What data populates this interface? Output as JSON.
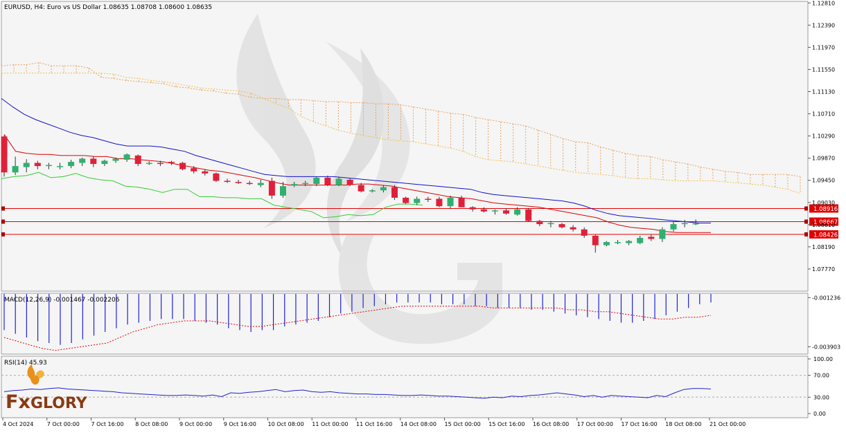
{
  "header": {
    "symbol_line": "EURUSD, H4:  Euro vs US Dollar  1.08635 1.08708 1.08600 1.08635"
  },
  "chart_data": {
    "type": "candlestick",
    "symbol": "EURUSD",
    "timeframe": "H4",
    "description": "Euro vs US Dollar",
    "ohlc_header": {
      "open": 1.08635,
      "high": 1.08708,
      "low": 1.086,
      "close": 1.08635
    },
    "price_axis": {
      "ylim": [
        1.0735,
        1.1284
      ],
      "ticks": [
        "1.12810",
        "1.12390",
        "1.11970",
        "1.11550",
        "1.11130",
        "1.10710",
        "1.10290",
        "1.09870",
        "1.09450",
        "1.09030",
        "1.08610",
        "1.08190",
        "1.07770"
      ]
    },
    "time_axis_labels": [
      "4 Oct 2024",
      "7 Oct 00:00",
      "7 Oct 16:00",
      "8 Oct 08:00",
      "9 Oct 00:00",
      "9 Oct 16:00",
      "10 Oct 08:00",
      "11 Oct 00:00",
      "11 Oct 16:00",
      "14 Oct 08:00",
      "15 Oct 00:00",
      "15 Oct 16:00",
      "16 Oct 08:00",
      "17 Oct 00:00",
      "17 Oct 16:00",
      "18 Oct 08:00",
      "21 Oct 00:00"
    ],
    "candles": [
      {
        "o": 1.1028,
        "h": 1.103,
        "l": 1.0952,
        "c": 1.096
      },
      {
        "o": 1.096,
        "h": 1.099,
        "l": 1.0955,
        "c": 1.0972
      },
      {
        "o": 1.097,
        "h": 1.0985,
        "l": 1.096,
        "c": 1.0978
      },
      {
        "o": 1.0978,
        "h": 1.0982,
        "l": 1.0966,
        "c": 1.0972
      },
      {
        "o": 1.0972,
        "h": 1.0978,
        "l": 1.0966,
        "c": 1.0974
      },
      {
        "o": 1.097,
        "h": 1.0978,
        "l": 1.0966,
        "c": 1.0972
      },
      {
        "o": 1.0972,
        "h": 1.0984,
        "l": 1.0968,
        "c": 1.098
      },
      {
        "o": 1.0978,
        "h": 1.0988,
        "l": 1.0972,
        "c": 1.0986
      },
      {
        "o": 1.0986,
        "h": 1.099,
        "l": 1.097,
        "c": 1.0976
      },
      {
        "o": 1.0976,
        "h": 1.0984,
        "l": 1.0972,
        "c": 1.0982
      },
      {
        "o": 1.0982,
        "h": 1.0988,
        "l": 1.0978,
        "c": 1.0986
      },
      {
        "o": 1.0984,
        "h": 1.0996,
        "l": 1.098,
        "c": 1.0994
      },
      {
        "o": 1.0992,
        "h": 1.0994,
        "l": 1.0972,
        "c": 1.0976
      },
      {
        "o": 1.0978,
        "h": 1.0981,
        "l": 1.0974,
        "c": 1.0978
      },
      {
        "o": 1.0978,
        "h": 1.0982,
        "l": 1.0972,
        "c": 1.0976
      },
      {
        "o": 1.098,
        "h": 1.0982,
        "l": 1.0974,
        "c": 1.0978
      },
      {
        "o": 1.0978,
        "h": 1.098,
        "l": 1.0964,
        "c": 1.0966
      },
      {
        "o": 1.0968,
        "h": 1.0972,
        "l": 1.0958,
        "c": 1.0962
      },
      {
        "o": 1.0962,
        "h": 1.0966,
        "l": 1.0954,
        "c": 1.0958
      },
      {
        "o": 1.0958,
        "h": 1.096,
        "l": 1.0942,
        "c": 1.0944
      },
      {
        "o": 1.0944,
        "h": 1.0948,
        "l": 1.094,
        "c": 1.0942
      },
      {
        "o": 1.0942,
        "h": 1.0946,
        "l": 1.0938,
        "c": 1.094
      },
      {
        "o": 1.094,
        "h": 1.0944,
        "l": 1.0936,
        "c": 1.0938
      },
      {
        "o": 1.0936,
        "h": 1.0946,
        "l": 1.0932,
        "c": 1.094
      },
      {
        "o": 1.0944,
        "h": 1.095,
        "l": 1.091,
        "c": 1.0916
      },
      {
        "o": 1.0916,
        "h": 1.0942,
        "l": 1.0912,
        "c": 1.0934
      },
      {
        "o": 1.0935,
        "h": 1.0942,
        "l": 1.0932,
        "c": 1.0938
      },
      {
        "o": 1.0938,
        "h": 1.0944,
        "l": 1.0934,
        "c": 1.094
      },
      {
        "o": 1.0938,
        "h": 1.0952,
        "l": 1.0934,
        "c": 1.095
      },
      {
        "o": 1.095,
        "h": 1.0954,
        "l": 1.0934,
        "c": 1.0936
      },
      {
        "o": 1.0936,
        "h": 1.0952,
        "l": 1.0934,
        "c": 1.0948
      },
      {
        "o": 1.0946,
        "h": 1.0949,
        "l": 1.0934,
        "c": 1.0936
      },
      {
        "o": 1.0936,
        "h": 1.094,
        "l": 1.0922,
        "c": 1.0924
      },
      {
        "o": 1.0924,
        "h": 1.0928,
        "l": 1.0922,
        "c": 1.0926
      },
      {
        "o": 1.0926,
        "h": 1.0936,
        "l": 1.0922,
        "c": 1.0932
      },
      {
        "o": 1.0932,
        "h": 1.0936,
        "l": 1.0908,
        "c": 1.0912
      },
      {
        "o": 1.0912,
        "h": 1.0914,
        "l": 1.09,
        "c": 1.0902
      },
      {
        "o": 1.0902,
        "h": 1.0914,
        "l": 1.0898,
        "c": 1.091
      },
      {
        "o": 1.091,
        "h": 1.0914,
        "l": 1.0904,
        "c": 1.0908
      },
      {
        "o": 1.091,
        "h": 1.0914,
        "l": 1.0894,
        "c": 1.0896
      },
      {
        "o": 1.0896,
        "h": 1.0916,
        "l": 1.0892,
        "c": 1.0912
      },
      {
        "o": 1.0912,
        "h": 1.0916,
        "l": 1.0894,
        "c": 1.0894
      },
      {
        "o": 1.0894,
        "h": 1.0896,
        "l": 1.0886,
        "c": 1.089
      },
      {
        "o": 1.089,
        "h": 1.0894,
        "l": 1.0884,
        "c": 1.0886
      },
      {
        "o": 1.0886,
        "h": 1.089,
        "l": 1.088,
        "c": 1.0888
      },
      {
        "o": 1.0888,
        "h": 1.0892,
        "l": 1.088,
        "c": 1.0882
      },
      {
        "o": 1.088,
        "h": 1.0894,
        "l": 1.0878,
        "c": 1.089
      },
      {
        "o": 1.089,
        "h": 1.0892,
        "l": 1.0866,
        "c": 1.0868
      },
      {
        "o": 1.0868,
        "h": 1.087,
        "l": 1.0858,
        "c": 1.0862
      },
      {
        "o": 1.0862,
        "h": 1.0868,
        "l": 1.0856,
        "c": 1.0864
      },
      {
        "o": 1.0862,
        "h": 1.0864,
        "l": 1.0854,
        "c": 1.0856
      },
      {
        "o": 1.0856,
        "h": 1.086,
        "l": 1.0848,
        "c": 1.0852
      },
      {
        "o": 1.0852,
        "h": 1.0856,
        "l": 1.0836,
        "c": 1.084
      },
      {
        "o": 1.084,
        "h": 1.0842,
        "l": 1.0808,
        "c": 1.0822
      },
      {
        "o": 1.0822,
        "h": 1.083,
        "l": 1.082,
        "c": 1.0828
      },
      {
        "o": 1.0826,
        "h": 1.0832,
        "l": 1.0824,
        "c": 1.0828
      },
      {
        "o": 1.0826,
        "h": 1.0832,
        "l": 1.0822,
        "c": 1.083
      },
      {
        "o": 1.0826,
        "h": 1.084,
        "l": 1.0824,
        "c": 1.0836
      },
      {
        "o": 1.0838,
        "h": 1.0842,
        "l": 1.083,
        "c": 1.0834
      },
      {
        "o": 1.0834,
        "h": 1.0856,
        "l": 1.0828,
        "c": 1.0852
      },
      {
        "o": 1.0852,
        "h": 1.0866,
        "l": 1.0848,
        "c": 1.0862
      },
      {
        "o": 1.0862,
        "h": 1.087,
        "l": 1.0856,
        "c": 1.0864
      },
      {
        "o": 1.08635,
        "h": 1.08708,
        "l": 1.086,
        "c": 1.08635
      }
    ],
    "ichimoku": {
      "kijun_blue": [
        1.11,
        1.1084,
        1.107,
        1.106,
        1.1052,
        1.1044,
        1.1036,
        1.103,
        1.1026,
        1.102,
        1.1014,
        1.101,
        1.101,
        1.101,
        1.1008,
        1.1004,
        1.1,
        1.0992,
        1.0986,
        1.098,
        1.0974,
        1.0968,
        1.0962,
        1.0956,
        1.0954,
        1.0952,
        1.0952,
        1.0952,
        1.0952,
        1.0952,
        1.095,
        1.0948,
        1.0946,
        1.0944,
        1.0942,
        1.094,
        1.0938,
        1.0936,
        1.0934,
        1.0932,
        1.093,
        1.0928,
        1.0922,
        1.0918,
        1.0916,
        1.0914,
        1.0912,
        1.091,
        1.0908,
        1.0906,
        1.0902,
        1.0896,
        1.0888,
        1.0882,
        1.0878,
        1.0876,
        1.0874,
        1.0872,
        1.087,
        1.0868,
        1.0866,
        1.0864,
        1.0864
      ],
      "tenkan_red": [
        1.1032,
        1.1,
        1.0996,
        1.0994,
        1.0994,
        1.0992,
        1.0992,
        1.0992,
        1.099,
        1.099,
        1.0986,
        1.0986,
        1.0984,
        1.0982,
        1.098,
        1.0976,
        1.0972,
        1.0968,
        1.0964,
        1.0962,
        1.0958,
        1.0954,
        1.095,
        1.0945,
        1.094,
        1.0936,
        1.0936,
        1.0936,
        1.0936,
        1.0936,
        1.0936,
        1.0938,
        1.0938,
        1.0936,
        1.0934,
        1.093,
        1.0926,
        1.0922,
        1.0918,
        1.0914,
        1.0912,
        1.091,
        1.0906,
        1.0902,
        1.09,
        1.0898,
        1.0896,
        1.0894,
        1.089,
        1.0886,
        1.0882,
        1.0878,
        1.0874,
        1.0866,
        1.086,
        1.0856,
        1.0854,
        1.0852,
        1.0848,
        1.0846,
        1.0846,
        1.0846,
        1.0846
      ],
      "chikou_green": [
        1.0948,
        1.0952,
        1.0954,
        1.096,
        1.095,
        1.0952,
        1.0958,
        1.095,
        1.0946,
        1.0944,
        1.0934,
        1.0932,
        1.0928,
        1.0922,
        1.0928,
        1.0928,
        1.0914,
        1.0914,
        1.0912,
        1.0912,
        1.091,
        1.091,
        1.0898,
        1.0894,
        1.089,
        1.0886,
        1.0874,
        1.0876,
        1.088,
        1.0878,
        1.088,
        1.0894,
        1.09,
        1.09,
        1.0898
      ],
      "cloud_upper": [
        1.1162,
        1.1164,
        1.1164,
        1.1168,
        1.1162,
        1.1162,
        1.1162,
        1.1158,
        1.114,
        1.1138,
        1.1134,
        1.1132,
        1.113,
        1.1128,
        1.1122,
        1.112,
        1.1116,
        1.1114,
        1.111,
        1.1108,
        1.1102,
        1.11,
        1.11,
        1.1098,
        1.1098,
        1.1096,
        1.1094,
        1.1094,
        1.1092,
        1.1092,
        1.109,
        1.109,
        1.1088,
        1.1084,
        1.108,
        1.1076,
        1.1072,
        1.107,
        1.1064,
        1.106,
        1.1056,
        1.1052,
        1.1048,
        1.104,
        1.1032,
        1.1024,
        1.1018,
        1.1016,
        1.1008,
        1.1002,
        1.0996,
        1.0992,
        1.099,
        1.0984,
        1.098,
        1.0976,
        1.097,
        1.0966,
        1.0962,
        1.096,
        1.0956,
        1.0956,
        1.0956,
        1.0956,
        1.0952
      ],
      "cloud_lower": [
        1.1148,
        1.1148,
        1.1148,
        1.1148,
        1.1148,
        1.1148,
        1.1148,
        1.1148,
        1.1148,
        1.1146,
        1.114,
        1.1138,
        1.1134,
        1.1132,
        1.1128,
        1.1124,
        1.112,
        1.1118,
        1.1116,
        1.1114,
        1.111,
        1.11,
        1.109,
        1.1082,
        1.1066,
        1.1056,
        1.1048,
        1.104,
        1.1034,
        1.103,
        1.1026,
        1.1022,
        1.102,
        1.1018,
        1.1014,
        1.101,
        1.1006,
        1.1,
        1.099,
        1.0984,
        1.0982,
        1.098,
        1.0976,
        1.0972,
        1.0968,
        1.0964,
        1.096,
        1.0958,
        1.0956,
        1.0954,
        1.095,
        1.0948,
        1.0948,
        1.0946,
        1.0944,
        1.0944,
        1.0944,
        1.0944,
        1.0942,
        1.094,
        1.0938,
        1.0936,
        1.0932,
        1.0928,
        1.092
      ]
    },
    "horizontal_levels": [
      {
        "price": 1.08916,
        "label": "1.08916"
      },
      {
        "price": 1.08667,
        "label": "1.08667"
      },
      {
        "price": 1.08426,
        "label": "1.08426"
      }
    ],
    "macd": {
      "label": "MACD(12,26,9) -0.001467 -0.002206",
      "ticks": [
        "-0.001236",
        "-0.003903"
      ],
      "ylim": [
        -0.0043,
        -0.001
      ],
      "histogram": [
        -0.003,
        -0.0032,
        -0.0034,
        -0.0036,
        -0.0037,
        -0.0038,
        -0.0037,
        -0.0035,
        -0.0033,
        -0.0031,
        -0.0029,
        -0.0027,
        -0.0026,
        -0.0025,
        -0.0024,
        -0.0024,
        -0.0024,
        -0.0025,
        -0.0026,
        -0.0027,
        -0.0029,
        -0.003,
        -0.0031,
        -0.003,
        -0.003,
        -0.0028,
        -0.0027,
        -0.0026,
        -0.0025,
        -0.0023,
        -0.0021,
        -0.002,
        -0.0018,
        -0.0017,
        -0.0016,
        -0.0015,
        -0.0015,
        -0.0015,
        -0.0015,
        -0.0016,
        -0.0016,
        -0.0016,
        -0.0017,
        -0.0017,
        -0.0018,
        -0.0018,
        -0.0018,
        -0.0019,
        -0.0019,
        -0.002,
        -0.0021,
        -0.0022,
        -0.0023,
        -0.0024,
        -0.0025,
        -0.0026,
        -0.0026,
        -0.0025,
        -0.0024,
        -0.0022,
        -0.002,
        -0.0018,
        -0.0016,
        -0.0015
      ],
      "signal": [
        -0.0034,
        -0.0036,
        -0.0038,
        -0.004,
        -0.0041,
        -0.004,
        -0.0039,
        -0.0038,
        -0.0037,
        -0.0034,
        -0.0031,
        -0.0029,
        -0.0027,
        -0.0026,
        -0.0025,
        -0.0025,
        -0.0025,
        -0.0026,
        -0.0027,
        -0.0028,
        -0.0028,
        -0.0027,
        -0.0026,
        -0.0025,
        -0.0024,
        -0.0023,
        -0.0022,
        -0.0021,
        -0.002,
        -0.0019,
        -0.0018,
        -0.0017,
        -0.0017,
        -0.0017,
        -0.0017,
        -0.0017,
        -0.0017,
        -0.0017,
        -0.0018,
        -0.0018,
        -0.0018,
        -0.0018,
        -0.0018,
        -0.0018,
        -0.0019,
        -0.0019,
        -0.002,
        -0.002,
        -0.0021,
        -0.0022,
        -0.0023,
        -0.0024,
        -0.0024,
        -0.0023,
        -0.0023,
        -0.0022
      ]
    },
    "rsi": {
      "label": "RSI(14) 45.93",
      "ticks": [
        "100.00",
        "70.00",
        "30.00",
        "0.00"
      ],
      "levels": [
        100,
        70,
        30,
        0
      ],
      "values": [
        40,
        42,
        43,
        45,
        44,
        46,
        47,
        45,
        44,
        43,
        42,
        41,
        40,
        38,
        37,
        36,
        35,
        34,
        33,
        33,
        34,
        33,
        32,
        34,
        31,
        38,
        37,
        39,
        40,
        42,
        44,
        40,
        42,
        43,
        40,
        39,
        40,
        38,
        37,
        36,
        36,
        35,
        35,
        34,
        33,
        33,
        34,
        33,
        32,
        32,
        31,
        30,
        29,
        28,
        30,
        29,
        32,
        31,
        33,
        34,
        36,
        38,
        36,
        34,
        31,
        33,
        30,
        33,
        32,
        31,
        30,
        29,
        33,
        31,
        38,
        44,
        46,
        46,
        45
      ]
    },
    "watermark_brand": "FxGlory"
  }
}
